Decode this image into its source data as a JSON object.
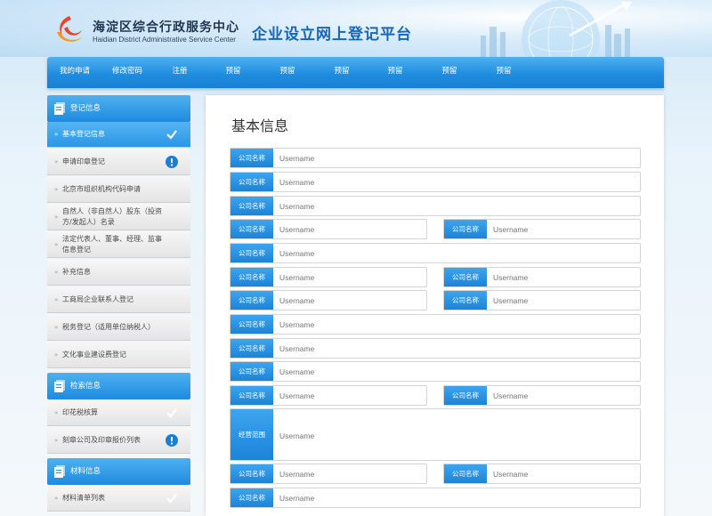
{
  "header": {
    "org_name_cn": "海淀区综合行政服务中心",
    "org_name_en": "Haidian District Administrative Service Center",
    "platform_title": "企业设立网上登记平台"
  },
  "nav": {
    "items": [
      "我的申请",
      "修改密码",
      "注册",
      "预留",
      "预留",
      "预留",
      "预留",
      "预留",
      "预留"
    ]
  },
  "sidebar": {
    "sections": [
      {
        "title": "登记信息",
        "items": [
          {
            "label": "基本登记信息",
            "status": "check"
          },
          {
            "label": "申请印章登记",
            "status": "alert"
          },
          {
            "label": "北京市组织机构代码申请",
            "status": ""
          },
          {
            "label": "自然人（非自然人）股东（投资方/发起人）名录",
            "status": ""
          },
          {
            "label": "法定代表人、董事、经理、监事信息登记",
            "status": ""
          },
          {
            "label": "补充信息",
            "status": ""
          },
          {
            "label": "工商局企业联系人登记",
            "status": ""
          },
          {
            "label": "税务登记（适用单位纳税人）",
            "status": ""
          },
          {
            "label": "文化事业建设费登记",
            "status": ""
          }
        ]
      },
      {
        "title": "检索信息",
        "items": [
          {
            "label": "印花税核算",
            "status": "check"
          },
          {
            "label": "刻章公司及印章报价列表",
            "status": "alert"
          }
        ]
      },
      {
        "title": "材料信息",
        "items": [
          {
            "label": "材料清单列表",
            "status": "check"
          }
        ]
      }
    ]
  },
  "form": {
    "title": "基本信息",
    "label": "公司名称",
    "scope_label": "经营范围",
    "placeholder": "Username"
  },
  "colors": {
    "accent": "#1f8de0",
    "check": "#ffffff",
    "alert": "#1a7fd2"
  }
}
